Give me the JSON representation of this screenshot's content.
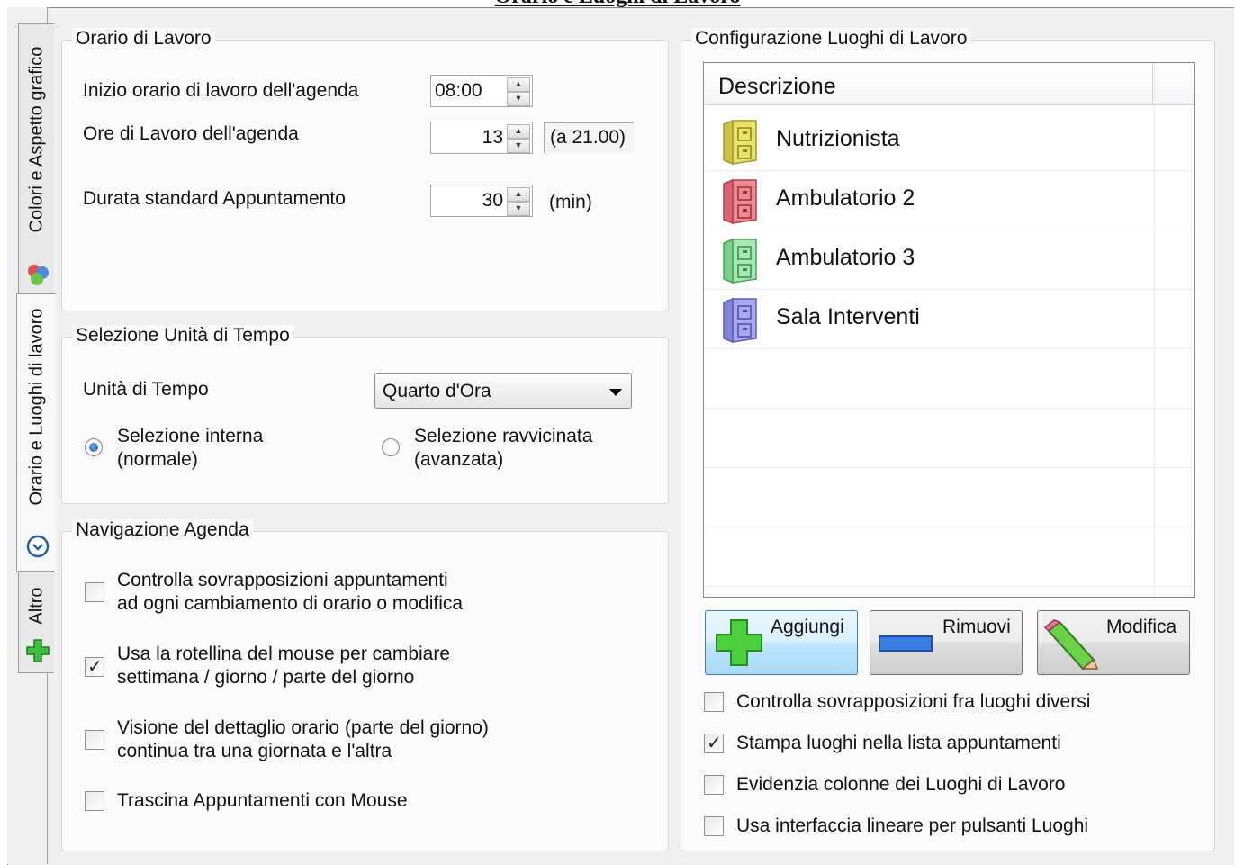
{
  "page_title": "Orario e Luoghi di Lavoro",
  "tabs": [
    {
      "label": "Colori e Aspetto grafico",
      "icon": "color-balls-icon"
    },
    {
      "label": "Orario e Luoghi di lavoro",
      "icon": "clock-icon"
    },
    {
      "label": "Altro",
      "icon": "green-plus-icon"
    }
  ],
  "orario": {
    "legend": "Orario di Lavoro",
    "inizio_label": "Inizio orario di lavoro dell'agenda",
    "inizio_value": "08:00",
    "ore_label": "Ore di Lavoro dell'agenda",
    "ore_value": "13",
    "ore_end": "(a 21.00)",
    "durata_label": "Durata standard Appuntamento",
    "durata_value": "30",
    "durata_unit": "(min)"
  },
  "unita": {
    "legend": "Selezione Unità di Tempo",
    "label": "Unità di Tempo",
    "selected": "Quarto d'Ora",
    "radio1_line1": "Selezione interna",
    "radio1_line2": "(normale)",
    "radio2_line1": "Selezione ravvicinata",
    "radio2_line2": "(avanzata)"
  },
  "navigazione": {
    "legend": "Navigazione Agenda",
    "items": [
      {
        "line1": "Controlla sovrapposizioni appuntamenti",
        "line2": "ad ogni cambiamento di orario o modifica",
        "checked": false
      },
      {
        "line1": "Usa la rotellina del mouse per cambiare",
        "line2": "settimana / giorno / parte del giorno",
        "checked": true
      },
      {
        "line1": "Visione del dettaglio orario (parte del giorno)",
        "line2": "continua tra una giornata e l'altra",
        "checked": false
      },
      {
        "line1": "Trascina Appuntamenti con Mouse",
        "line2": "",
        "checked": false
      }
    ]
  },
  "luoghi": {
    "legend": "Configurazione Luoghi di Lavoro",
    "column_header": "Descrizione",
    "rows": [
      {
        "name": "Nutrizionista",
        "color": "#e8e46a"
      },
      {
        "name": "Ambulatorio 2",
        "color": "#f08a92"
      },
      {
        "name": "Ambulatorio 3",
        "color": "#8fe0a0"
      },
      {
        "name": "Sala Interventi",
        "color": "#9a9ce8"
      }
    ],
    "btn_add": "Aggiungi",
    "btn_remove": "Rimuovi",
    "btn_edit": "Modifica",
    "options": [
      {
        "label": "Controlla sovrapposizioni fra luoghi diversi",
        "checked": false
      },
      {
        "label": "Stampa luoghi nella lista appuntamenti",
        "checked": true
      },
      {
        "label": "Evidenzia colonne dei Luoghi di Lavoro",
        "checked": false
      },
      {
        "label": "Usa interfaccia lineare per pulsanti Luoghi",
        "checked": false
      }
    ]
  }
}
